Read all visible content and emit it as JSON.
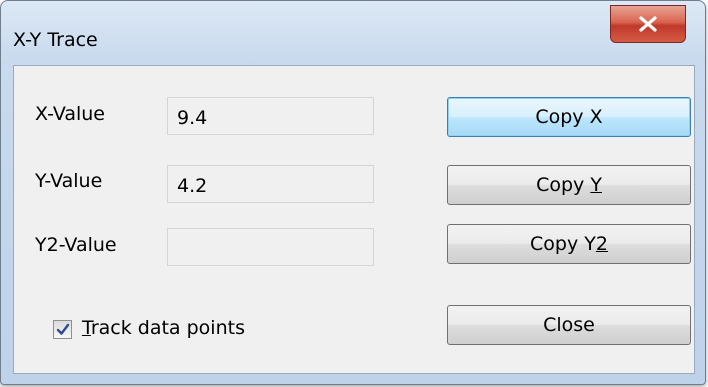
{
  "window": {
    "title": "X-Y Trace",
    "close_icon": "close-icon"
  },
  "fields": {
    "x": {
      "label": "X-Value",
      "value": "9.4"
    },
    "y": {
      "label": "Y-Value",
      "value": "4.2"
    },
    "y2": {
      "label": "Y2-Value",
      "value": ""
    }
  },
  "buttons": {
    "copy_x": "Copy X",
    "copy_y_prefix": "Copy ",
    "copy_y_accel": "Y",
    "copy_y2_prefix": "Copy Y",
    "copy_y2_accel": "2",
    "close": "Close"
  },
  "checkbox": {
    "accel": "T",
    "label_rest": "rack data points",
    "checked": true
  },
  "colors": {
    "close_button": "#c0392b",
    "default_button_border": "#3c7fb1",
    "check_mark": "#2b4d8c"
  }
}
